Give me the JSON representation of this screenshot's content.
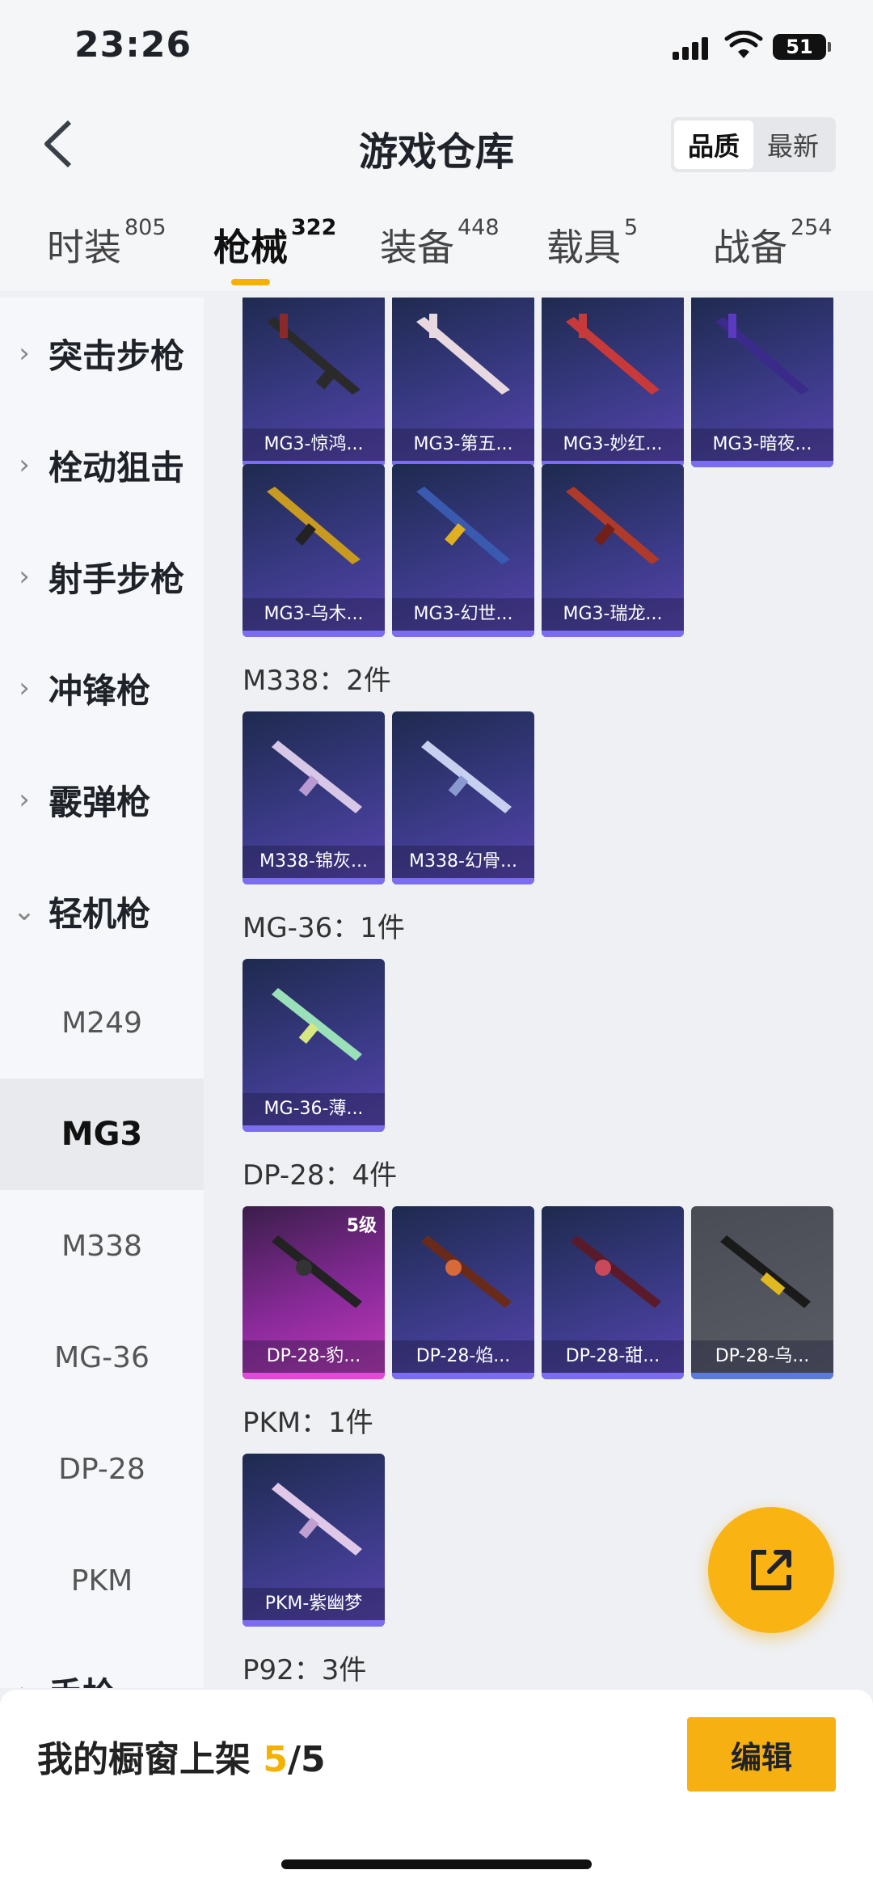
{
  "status": {
    "time": "23:26",
    "battery": "51"
  },
  "header": {
    "title": "游戏仓库",
    "sort_quality": "品质",
    "sort_latest": "最新"
  },
  "tabs": [
    {
      "label": "时装",
      "count": "805"
    },
    {
      "label": "枪械",
      "count": "322"
    },
    {
      "label": "装备",
      "count": "448"
    },
    {
      "label": "载具",
      "count": "5"
    },
    {
      "label": "战备",
      "count": "254"
    }
  ],
  "sidebar": {
    "categories": [
      "突击步枪",
      "栓动狙击",
      "射手步枪",
      "冲锋枪",
      "霰弹枪",
      "轻机枪"
    ],
    "subs": [
      "M249",
      "MG3",
      "M338",
      "MG-36",
      "DP-28",
      "PKM"
    ],
    "partial": "手枪"
  },
  "groups": {
    "m338": "M338：2件",
    "mg36": "MG-36：1件",
    "dp28": "DP-28：4件",
    "pkm": "PKM：1件",
    "p92": "P92：3件"
  },
  "cards": {
    "mg3": [
      "MG3-惊鸿...",
      "MG3-第五...",
      "MG3-妙红...",
      "MG3-暗夜...",
      "MG3-乌木...",
      "MG3-幻世...",
      "MG3-瑞龙..."
    ],
    "m338": [
      "M338-锦灰...",
      "M338-幻骨..."
    ],
    "mg36": [
      "MG-36-薄..."
    ],
    "dp28": [
      "DP-28-豹...",
      "DP-28-焰...",
      "DP-28-甜...",
      "DP-28-乌..."
    ],
    "dp28_level": "5级",
    "pkm": [
      "PKM-紫幽梦"
    ]
  },
  "bottom": {
    "shelf_label": "我的橱窗上架 ",
    "shelf_count": "5",
    "shelf_total": "/5",
    "edit": "编辑"
  },
  "colors": {
    "accent": "#f5b100",
    "card_purple": "#3a3a86",
    "card_pink": "#c23ab8",
    "card_gray": "#5a5c66"
  }
}
